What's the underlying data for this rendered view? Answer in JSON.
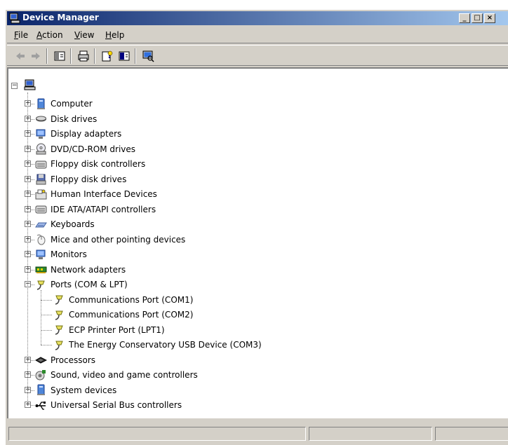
{
  "window": {
    "title": "Device Manager"
  },
  "menu": [
    {
      "label": "File",
      "ul": "F",
      "rest": "ile"
    },
    {
      "label": "Action",
      "ul": "A",
      "rest": "ction"
    },
    {
      "label": "View",
      "ul": "V",
      "rest": "iew"
    },
    {
      "label": "Help",
      "ul": "H",
      "rest": "elp"
    }
  ],
  "toolbar_icons": [
    "back-arrow-icon",
    "forward-arrow-icon",
    "properties-icon",
    "print-icon",
    "help-icon",
    "console-tree-icon",
    "scan-hardware-icon"
  ],
  "tree": {
    "root_icon": "computer-root-icon",
    "categories": [
      {
        "label": "Computer",
        "icon": "computer-icon"
      },
      {
        "label": "Disk drives",
        "icon": "disk-drive-icon"
      },
      {
        "label": "Display adapters",
        "icon": "display-adapter-icon"
      },
      {
        "label": "DVD/CD-ROM drives",
        "icon": "cdrom-icon"
      },
      {
        "label": "Floppy disk controllers",
        "icon": "floppy-controller-icon"
      },
      {
        "label": "Floppy disk drives",
        "icon": "floppy-drive-icon"
      },
      {
        "label": "Human Interface Devices",
        "icon": "hid-icon"
      },
      {
        "label": "IDE ATA/ATAPI controllers",
        "icon": "ide-controller-icon"
      },
      {
        "label": "Keyboards",
        "icon": "keyboard-icon"
      },
      {
        "label": "Mice and other pointing devices",
        "icon": "mouse-icon"
      },
      {
        "label": "Monitors",
        "icon": "monitor-icon"
      },
      {
        "label": "Network adapters",
        "icon": "network-adapter-icon"
      },
      {
        "label": "Ports (COM & LPT)",
        "icon": "port-icon",
        "expanded": true,
        "children": [
          {
            "label": "Communications Port (COM1)",
            "icon": "port-icon"
          },
          {
            "label": "Communications Port (COM2)",
            "icon": "port-icon"
          },
          {
            "label": "ECP Printer Port (LPT1)",
            "icon": "port-icon"
          },
          {
            "label": "The Energy Conservatory USB Device (COM3)",
            "icon": "port-icon"
          }
        ]
      },
      {
        "label": "Processors",
        "icon": "processor-icon"
      },
      {
        "label": "Sound, video and game controllers",
        "icon": "sound-icon"
      },
      {
        "label": "System devices",
        "icon": "system-device-icon"
      },
      {
        "label": "Universal Serial Bus controllers",
        "icon": "usb-icon"
      }
    ]
  },
  "colors": {
    "titlebar_start": "#0a246a",
    "titlebar_end": "#a6caf0",
    "chrome": "#d4d0c8"
  }
}
